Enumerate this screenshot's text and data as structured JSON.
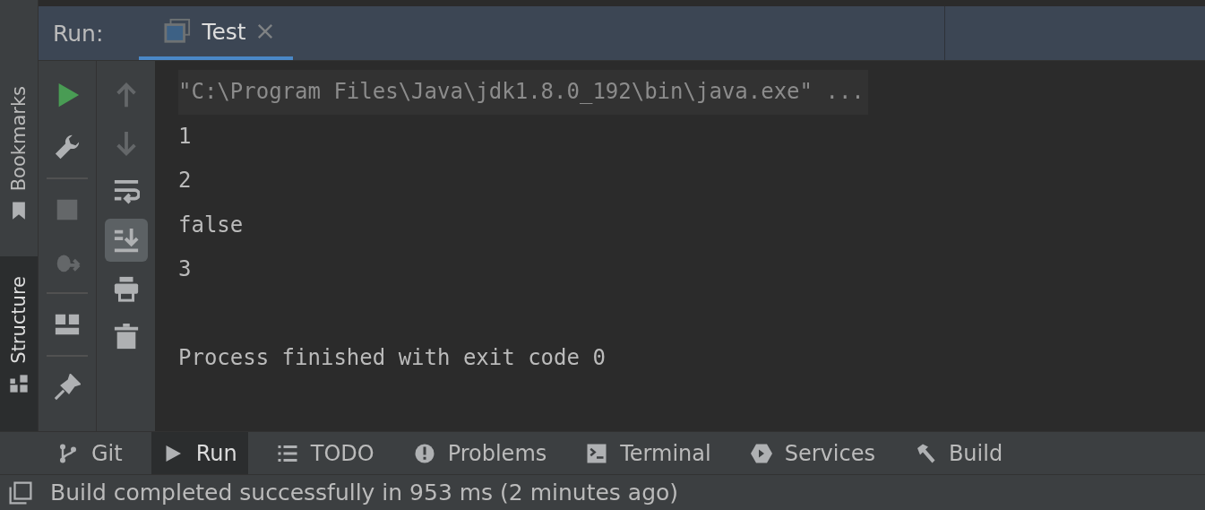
{
  "side_tabs": [
    {
      "label": "Bookmarks",
      "kind": "bookmark",
      "selected": false
    },
    {
      "label": "Structure",
      "kind": "structure",
      "selected": true
    }
  ],
  "run_panel": {
    "title": "Run:",
    "tabs": [
      {
        "label": "Test",
        "selected": true
      }
    ]
  },
  "toolbar_main": [
    {
      "kind": "run",
      "disabled": false
    },
    {
      "kind": "wrench",
      "disabled": false
    },
    {
      "kind": "stop",
      "disabled": true
    },
    {
      "kind": "debug",
      "disabled": true
    },
    {
      "kind": "layout",
      "disabled": false
    },
    {
      "kind": "pin",
      "disabled": false
    }
  ],
  "toolbar_console": [
    {
      "kind": "up",
      "disabled": true,
      "selected": false
    },
    {
      "kind": "down",
      "disabled": true,
      "selected": false
    },
    {
      "kind": "wrap",
      "disabled": false,
      "selected": false
    },
    {
      "kind": "scroll",
      "disabled": false,
      "selected": true
    },
    {
      "kind": "print",
      "disabled": false,
      "selected": false
    },
    {
      "kind": "trash",
      "disabled": false,
      "selected": false
    }
  ],
  "console": [
    {
      "kind": "command",
      "text": "\"C:\\Program Files\\Java\\jdk1.8.0_192\\bin\\java.exe\" ..."
    },
    {
      "kind": "output",
      "text": "1"
    },
    {
      "kind": "output",
      "text": "2"
    },
    {
      "kind": "output",
      "text": "false"
    },
    {
      "kind": "output",
      "text": "3"
    },
    {
      "kind": "blank"
    },
    {
      "kind": "output",
      "text": "Process finished with exit code 0"
    }
  ],
  "bottom_tabs": [
    {
      "label": "Git",
      "kind": "git",
      "selected": false
    },
    {
      "label": "Run",
      "kind": "run",
      "selected": true
    },
    {
      "label": "TODO",
      "kind": "list",
      "selected": false
    },
    {
      "label": "Problems",
      "kind": "alert",
      "selected": false
    },
    {
      "label": "Terminal",
      "kind": "terminal",
      "selected": false
    },
    {
      "label": "Services",
      "kind": "services",
      "selected": false
    },
    {
      "label": "Build",
      "kind": "hammer",
      "selected": false
    }
  ],
  "status_bar": {
    "message": "Build completed successfully in 953 ms (2 minutes ago)"
  }
}
